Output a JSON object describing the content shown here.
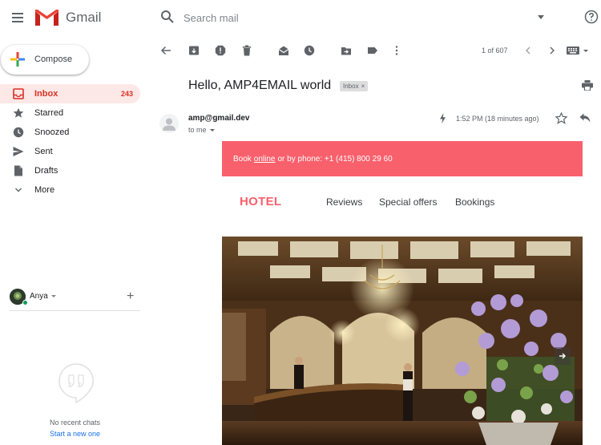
{
  "header": {
    "app_name": "Gmail",
    "search_placeholder": "Search mail"
  },
  "compose": {
    "label": "Compose"
  },
  "sidebar": {
    "items": [
      {
        "label": "Inbox",
        "count": "243",
        "icon": "inbox-icon",
        "active": true
      },
      {
        "label": "Starred",
        "icon": "star-icon"
      },
      {
        "label": "Snoozed",
        "icon": "clock-icon"
      },
      {
        "label": "Sent",
        "icon": "send-icon"
      },
      {
        "label": "Drafts",
        "icon": "draft-icon"
      },
      {
        "label": "More",
        "icon": "chevron-down-icon"
      }
    ]
  },
  "hangouts": {
    "user_name": "Anya",
    "no_chats": "No recent chats",
    "start_new": "Start a new one"
  },
  "toolbar": {
    "pager": "1 of 607"
  },
  "email": {
    "subject": "Hello, AMP4EMAIL world",
    "label": "Inbox",
    "sender": "amp@gmail.dev",
    "to": "to me",
    "time": "1:52 PM (18 minutes ago)",
    "banner": {
      "prefix": "Book",
      "link": "online",
      "suffix": "or by phone: +1 (415) 800 29 60"
    },
    "brand": "HOTEL",
    "nav": [
      "Reviews",
      "Special offers",
      "Bookings"
    ]
  },
  "colors": {
    "accent_red": "#d93025",
    "banner": "#f8606c",
    "active_bg": "#fce8e6",
    "link_blue": "#1a73e8"
  }
}
